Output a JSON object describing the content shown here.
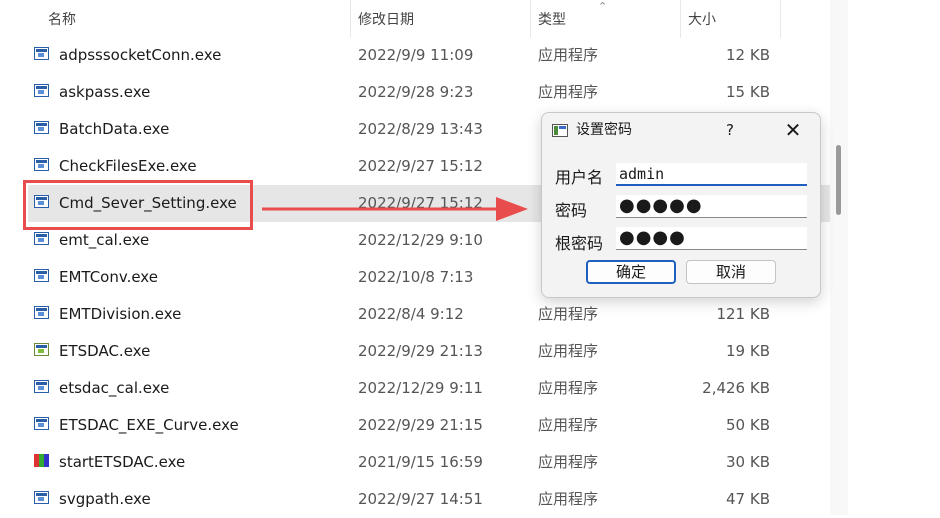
{
  "columns": {
    "name": "名称",
    "date": "修改日期",
    "type": "类型",
    "size": "大小"
  },
  "files": [
    {
      "name": "adpsssocketConn.exe",
      "date": "2022/9/9 11:09",
      "type": "应用程序",
      "size": "12 KB",
      "icon": "exe-window-icon"
    },
    {
      "name": "askpass.exe",
      "date": "2022/9/28 9:23",
      "type": "应用程序",
      "size": "15 KB",
      "icon": "exe-window-icon"
    },
    {
      "name": "BatchData.exe",
      "date": "2022/8/29 13:43",
      "type": "",
      "size": "",
      "icon": "exe-window-icon"
    },
    {
      "name": "CheckFilesExe.exe",
      "date": "2022/9/27 15:12",
      "type": "",
      "size": "",
      "icon": "exe-window-icon"
    },
    {
      "name": "Cmd_Sever_Setting.exe",
      "date": "2022/9/27 15:12",
      "type": "",
      "size": "",
      "icon": "exe-window-icon",
      "selected": true
    },
    {
      "name": "emt_cal.exe",
      "date": "2022/12/29 9:10",
      "type": "",
      "size": "",
      "icon": "exe-window-icon"
    },
    {
      "name": "EMTConv.exe",
      "date": "2022/10/8 7:13",
      "type": "",
      "size": "",
      "icon": "exe-window-icon"
    },
    {
      "name": "EMTDivision.exe",
      "date": "2022/8/4 9:12",
      "type": "应用程序",
      "size": "121 KB",
      "icon": "exe-window-icon"
    },
    {
      "name": "ETSDAC.exe",
      "date": "2022/9/29 21:13",
      "type": "应用程序",
      "size": "19 KB",
      "icon": "exe-special-icon"
    },
    {
      "name": "etsdac_cal.exe",
      "date": "2022/12/29 9:11",
      "type": "应用程序",
      "size": "2,426 KB",
      "icon": "exe-window-icon"
    },
    {
      "name": "ETSDAC_EXE_Curve.exe",
      "date": "2022/9/29 21:15",
      "type": "应用程序",
      "size": "50 KB",
      "icon": "exe-window-icon"
    },
    {
      "name": "startETSDAC.exe",
      "date": "2021/9/15 16:59",
      "type": "应用程序",
      "size": "30 KB",
      "icon": "multicolor-app-icon"
    },
    {
      "name": "svgpath.exe",
      "date": "2022/9/27 14:51",
      "type": "应用程序",
      "size": "47 KB",
      "icon": "exe-window-icon"
    }
  ],
  "dialog": {
    "title": "设置密码",
    "help": "?",
    "close": "✕",
    "username_label": "用户名",
    "username_value": "admin",
    "password_label": "密码",
    "password_mask": "●●●●●",
    "root_password_label": "根密码",
    "root_password_mask": "●●●●",
    "ok_label": "确定",
    "cancel_label": "取消"
  },
  "colors": {
    "annotation": "#e84c4c",
    "focus": "#1f5fbf"
  }
}
